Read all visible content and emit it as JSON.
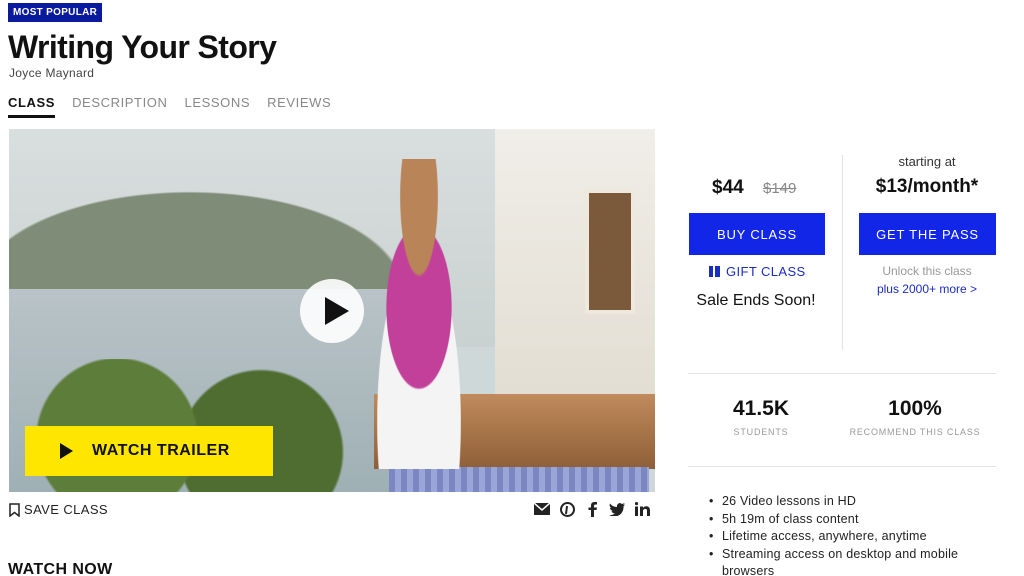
{
  "badge": "MOST POPULAR",
  "class_title": "Writing Your Story",
  "instructor": "Joyce Maynard",
  "tabs": [
    {
      "label": "CLASS",
      "active": true
    },
    {
      "label": "DESCRIPTION",
      "active": false
    },
    {
      "label": "LESSONS",
      "active": false
    },
    {
      "label": "REVIEWS",
      "active": false
    }
  ],
  "video": {
    "trailer_label": "WATCH TRAILER",
    "play_icon": "play-icon"
  },
  "actions": {
    "save_label": "SAVE CLASS",
    "share_icons": [
      "email-icon",
      "pinterest-icon",
      "facebook-icon",
      "twitter-icon",
      "linkedin-icon"
    ]
  },
  "section_heading": "WATCH NOW",
  "purchase": {
    "price": "$44",
    "original_price": "$149",
    "buy_label": "BUY CLASS",
    "gift_label": "GIFT CLASS",
    "sale_text": "Sale Ends Soon!"
  },
  "pass": {
    "starting_at": "starting at",
    "price": "$13/month*",
    "button_label": "GET THE PASS",
    "unlock_text": "Unlock this class",
    "more_link": "plus 2000+ more >"
  },
  "stats": [
    {
      "value": "41.5K",
      "label": "STUDENTS"
    },
    {
      "value": "100%",
      "label": "RECOMMEND THIS CLASS"
    }
  ],
  "features": [
    "26 Video lessons in HD",
    "5h 19m of class content",
    "Lifetime access, anywhere, anytime",
    "Streaming access on desktop and mobile",
    "browsers"
  ],
  "colors": {
    "brand_blue": "#1126e6",
    "badge_navy": "#0a1a9c",
    "trailer_yellow": "#ffe600"
  }
}
